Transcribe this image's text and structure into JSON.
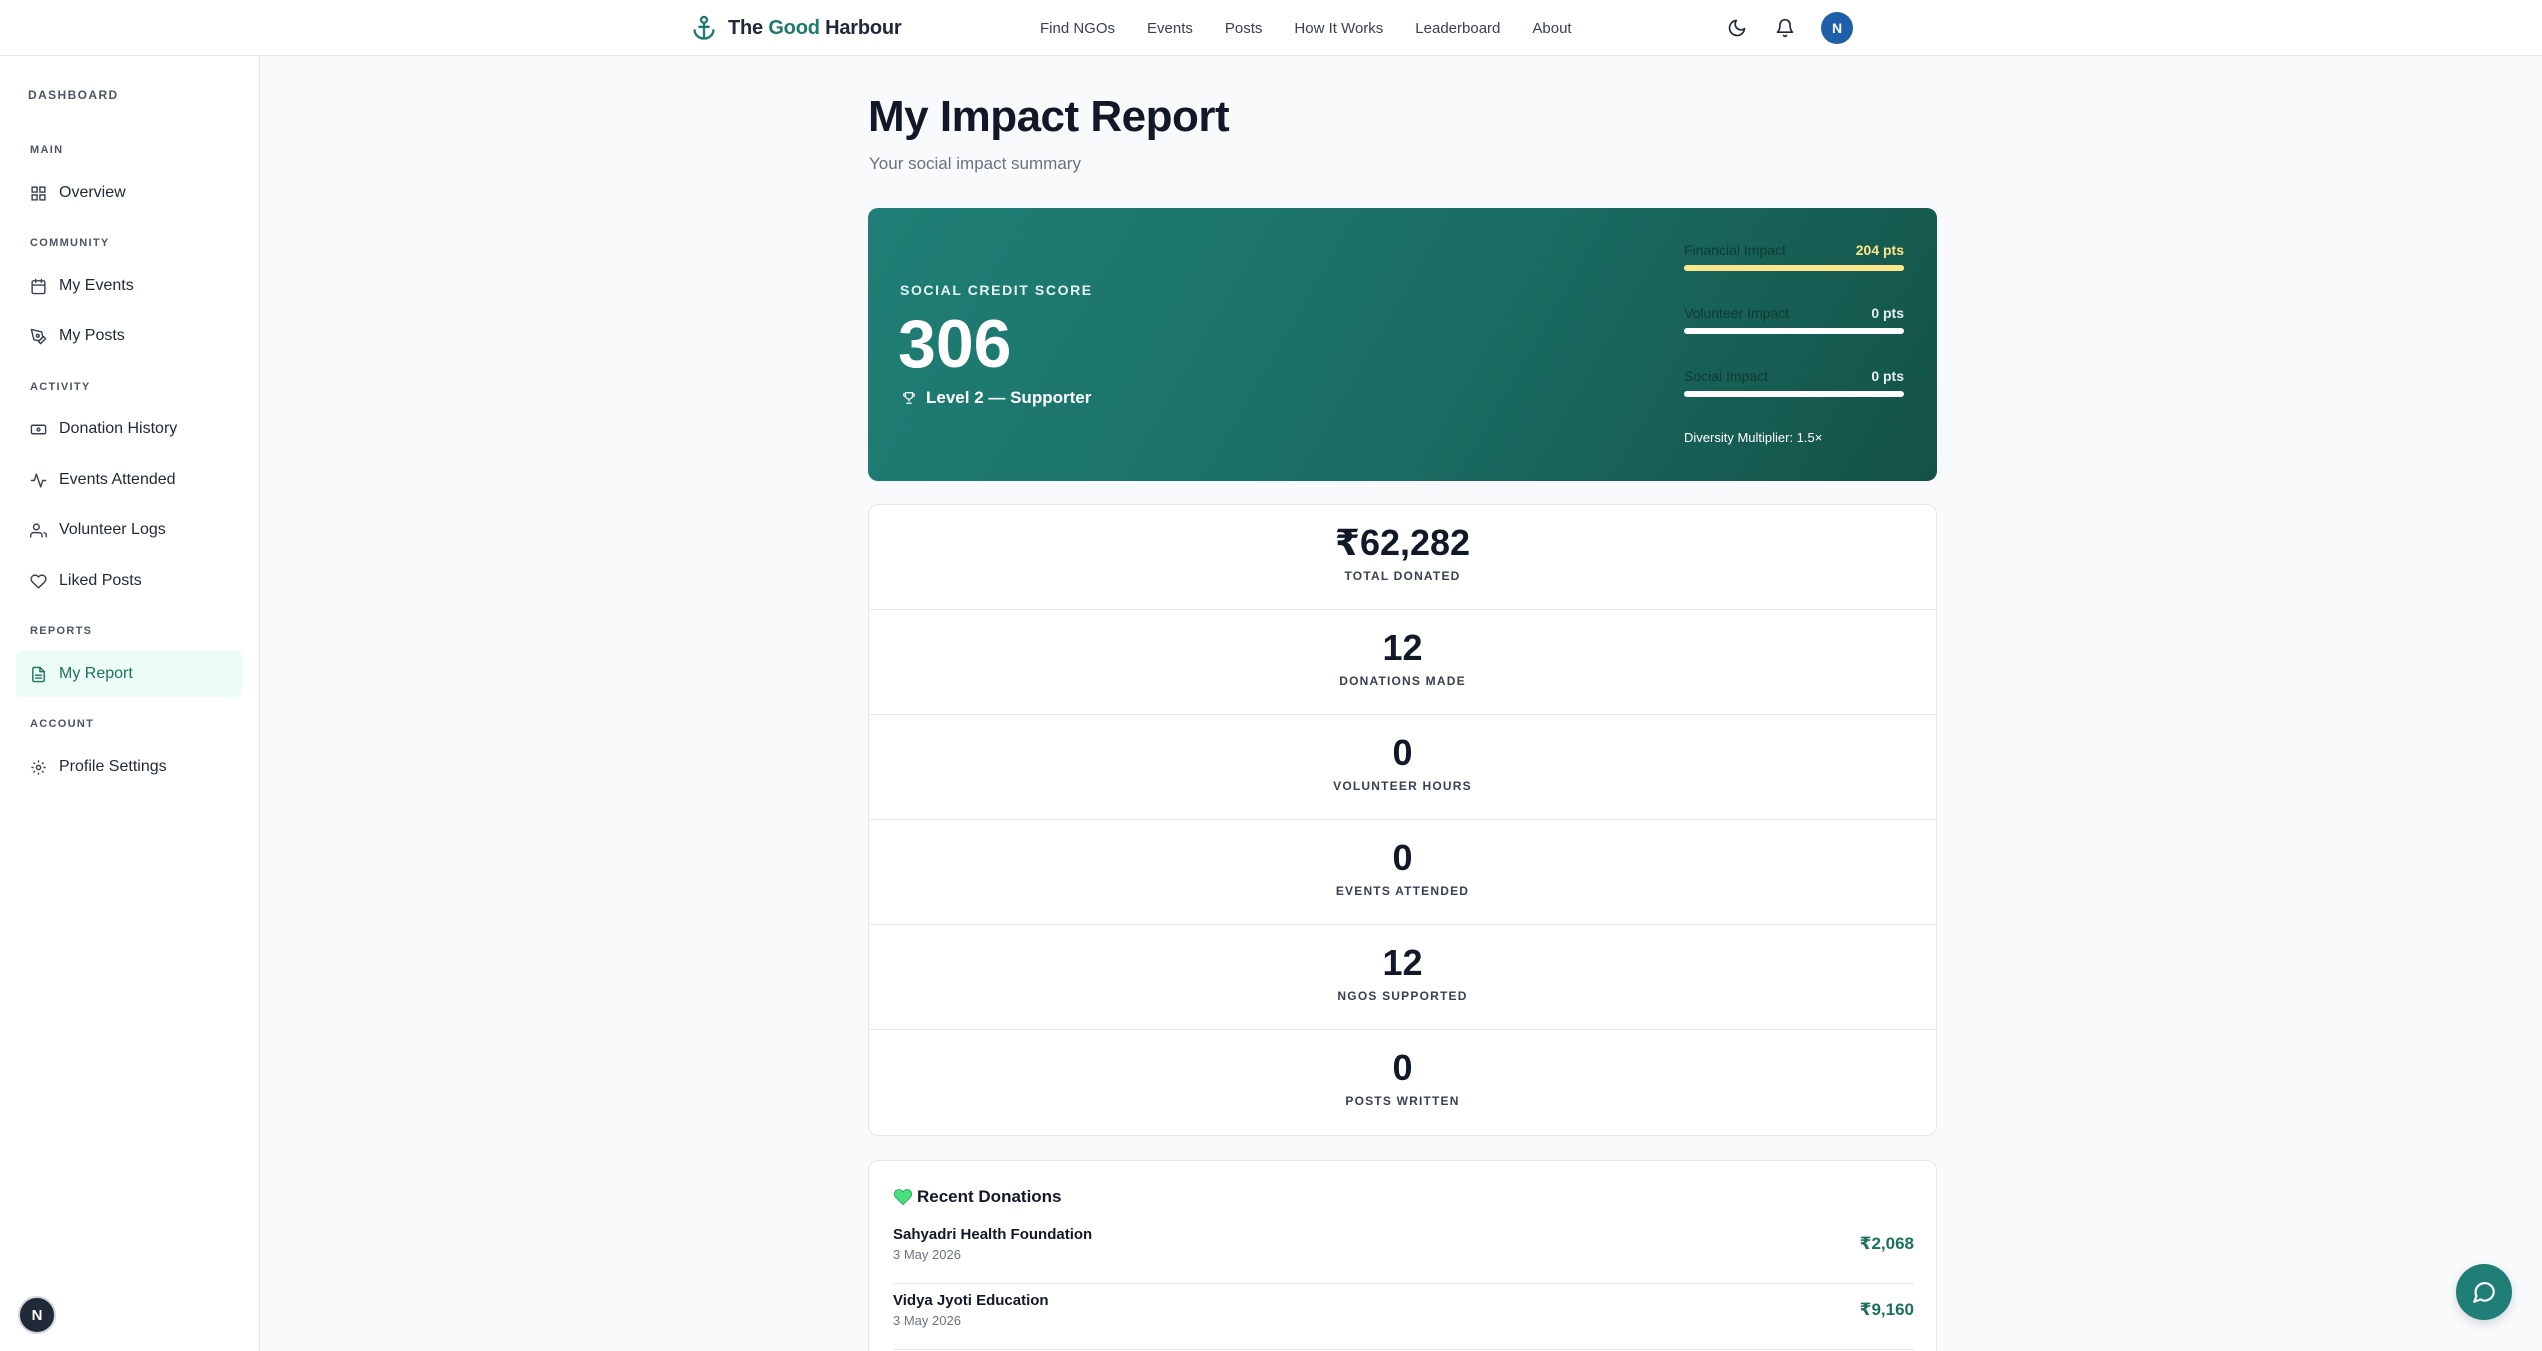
{
  "brand": {
    "prefix": "The ",
    "accent": "Good",
    "suffix": " Harbour"
  },
  "nav": [
    "Find NGOs",
    "Events",
    "Posts",
    "How It Works",
    "Leaderboard",
    "About"
  ],
  "user": {
    "initial": "N"
  },
  "sidebar": {
    "heading": "DASHBOARD",
    "groups": {
      "main": "MAIN",
      "community": "COMMUNITY",
      "activity": "ACTIVITY",
      "reports": "REPORTS",
      "account": "ACCOUNT"
    },
    "items": {
      "overview": "Overview",
      "my_events": "My Events",
      "my_posts": "My Posts",
      "donation_history": "Donation History",
      "events_attended": "Events Attended",
      "volunteer_logs": "Volunteer Logs",
      "liked_posts": "Liked Posts",
      "my_report": "My Report",
      "profile_settings": "Profile Settings"
    },
    "active": "my_report"
  },
  "page": {
    "title": "My Impact Report",
    "subtitle": "Your social impact summary"
  },
  "score": {
    "label": "SOCIAL CREDIT SCORE",
    "value": "306",
    "level": "Level 2 — Supporter",
    "impacts": [
      {
        "name": "Financial Impact",
        "pts": "204 pts",
        "fill": 1.0
      },
      {
        "name": "Volunteer Impact",
        "pts": "0 pts",
        "fill": 0.0
      },
      {
        "name": "Social Impact",
        "pts": "0 pts",
        "fill": 0.0
      }
    ],
    "multiplier": "Diversity Multiplier: 1.5×"
  },
  "stats": [
    {
      "value": "₹62,282",
      "label": "TOTAL DONATED"
    },
    {
      "value": "12",
      "label": "DONATIONS MADE"
    },
    {
      "value": "0",
      "label": "VOLUNTEER HOURS"
    },
    {
      "value": "0",
      "label": "EVENTS ATTENDED"
    },
    {
      "value": "12",
      "label": "NGOS SUPPORTED"
    },
    {
      "value": "0",
      "label": "POSTS WRITTEN"
    }
  ],
  "donations": {
    "title": "Recent Donations",
    "items": [
      {
        "name": "Sahyadri Health Foundation",
        "date": "3 May 2026",
        "amount": "₹2,068"
      },
      {
        "name": "Vidya Jyoti Education",
        "date": "3 May 2026",
        "amount": "₹9,160"
      }
    ]
  },
  "colors": {
    "brand": "#1f7f76",
    "accent_gold": "#fde68a",
    "avatar_blue": "#1d5fa8"
  }
}
